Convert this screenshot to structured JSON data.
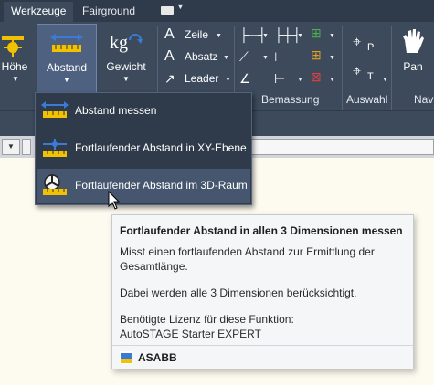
{
  "tabs": [
    {
      "label": "Werkzeuge",
      "active": true
    },
    {
      "label": "Fairground",
      "active": false
    }
  ],
  "ribbon": {
    "hoehe": {
      "label": "Höhe"
    },
    "abstand": {
      "label": "Abstand",
      "icon": "tape-measure-icon"
    },
    "gewicht": {
      "label": "Gewicht",
      "unit": "kg",
      "icon": "weight-icon"
    },
    "text_tools": [
      {
        "label": "Zeile",
        "icon": "text-line-icon"
      },
      {
        "label": "Absatz",
        "icon": "text-paragraph-icon"
      },
      {
        "label": "Leader",
        "icon": "leader-icon"
      }
    ],
    "pan": {
      "label": "Pan",
      "icon": "hand-icon"
    },
    "panels": {
      "bemassung": "Bemassung",
      "auswahl": "Auswahl",
      "nav": "Nav"
    }
  },
  "dropdown": {
    "items": [
      {
        "label": "Abstand messen",
        "icon": "measure-distance-icon"
      },
      {
        "label": "Fortlaufender Abstand in XY-Ebene",
        "icon": "continuous-distance-xy-icon"
      },
      {
        "label": "Fortlaufender Abstand im 3D-Raum",
        "icon": "continuous-distance-3d-icon"
      }
    ]
  },
  "tooltip": {
    "title": "Fortlaufender Abstand in allen 3 Dimensionen messen",
    "line1": "Misst einen fortlaufenden Abstand zur Ermittlung der",
    "line2": "Gesamtlänge.",
    "line3": "Dabei werden alle 3 Dimensionen berücksichtigt.",
    "line4": "Benötigte Lizenz für diese Funktion:",
    "line5": "AutoSTAGE Starter EXPERT",
    "brand": "ASABB"
  },
  "colors": {
    "ribbon_bg": "#3c4a5c",
    "tabbar_bg": "#2f3a4a",
    "canvas_bg": "#fdfaf0",
    "accent_yellow": "#f2c200",
    "accent_blue": "#3a7bd5"
  }
}
